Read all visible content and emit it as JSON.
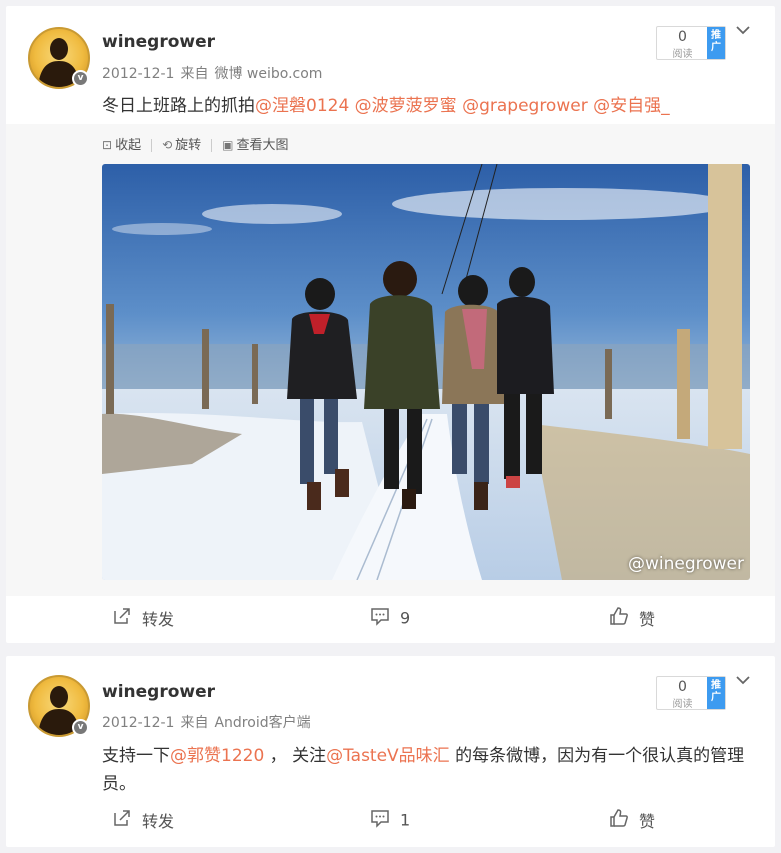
{
  "posts": [
    {
      "username": "winegrower",
      "date": "2012-12-1",
      "source_prefix": "来自",
      "source": "微博 weibo.com",
      "text_plain": "冬日上班路上的抓拍",
      "mentions": [
        "@涅磐0124",
        "@波萝菠罗蜜",
        "@grapegrower",
        "@安自强_"
      ],
      "read_count": "0",
      "read_label": "阅读",
      "promo_label": "推广",
      "media_tools": [
        "收起",
        "旋转",
        "查看大图"
      ],
      "watermark": "@winegrower",
      "actions": {
        "repost": "转发",
        "comment": "9",
        "like": "赞"
      }
    },
    {
      "username": "winegrower",
      "date": "2012-12-1",
      "source_prefix": "来自",
      "source": "Android客户端",
      "text_a": "支持一下",
      "mention_1": "@郭赞1220",
      "text_b": " ，  关注",
      "mention_2": "@TasteV品味汇",
      "text_c": " 的每条微博，因为有一个很认真的管理员。",
      "read_count": "0",
      "read_label": "阅读",
      "promo_label": "推广",
      "actions": {
        "repost": "转发",
        "comment": "1",
        "like": "赞"
      }
    }
  ],
  "colors": {
    "link": "#eb7350",
    "promo": "#3d9bf0",
    "background": "#f2f2f5"
  },
  "icons": [
    "verified-icon",
    "chevron-down-icon",
    "collapse-icon",
    "rotate-icon",
    "view-large-icon",
    "repost-icon",
    "comment-icon",
    "like-icon"
  ]
}
